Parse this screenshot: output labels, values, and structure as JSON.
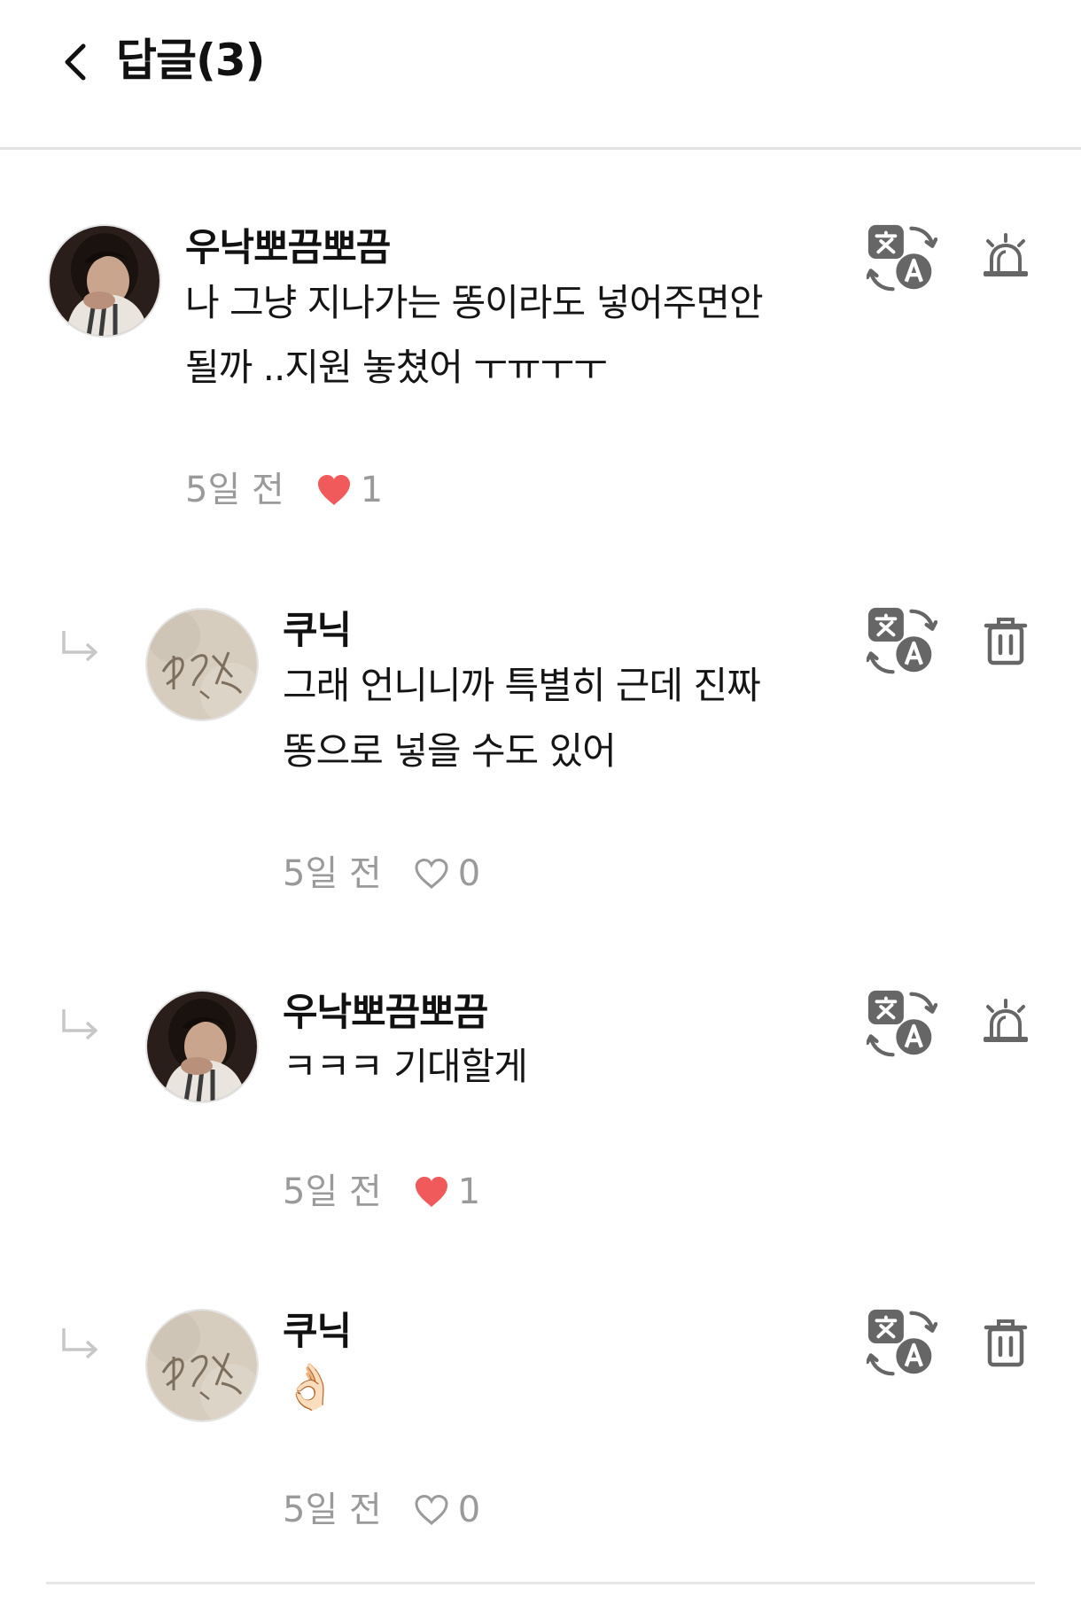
{
  "header": {
    "title": "답글(3)",
    "back_icon": "chevron-left-icon"
  },
  "colors": {
    "heart_liked": "#f05a5a",
    "meta_gray": "#9a9a9a",
    "icon_gray": "#666666",
    "divider": "#e2e2e2"
  },
  "comments": [
    {
      "author": "우낙뽀끔뽀끔",
      "lines": [
        "나 그냥 지나가는 똥이라도 넣어주면안",
        "될까 ..지원 놓쳤어 ㅜㅠㅜㅜ"
      ],
      "time": "5일 전",
      "likes": "1",
      "liked": true,
      "actions": [
        "translate-icon",
        "report-siren-icon"
      ]
    },
    {
      "author": "쿠닉",
      "lines": [
        "그래 언니니까 특별히 근데 진짜",
        "똥으로 넣을 수도 있어"
      ],
      "time": "5일 전",
      "likes": "0",
      "liked": false,
      "actions": [
        "translate-icon",
        "trash-icon"
      ]
    },
    {
      "author": "우낙뽀끔뽀끔",
      "lines": [
        "ㅋㅋㅋ 기대할게"
      ],
      "time": "5일 전",
      "likes": "1",
      "liked": true,
      "actions": [
        "translate-icon",
        "report-siren-icon"
      ]
    },
    {
      "author": "쿠닉",
      "lines": [
        "👌🏻"
      ],
      "time": "5일 전",
      "likes": "0",
      "liked": false,
      "actions": [
        "translate-icon",
        "trash-icon"
      ]
    }
  ]
}
